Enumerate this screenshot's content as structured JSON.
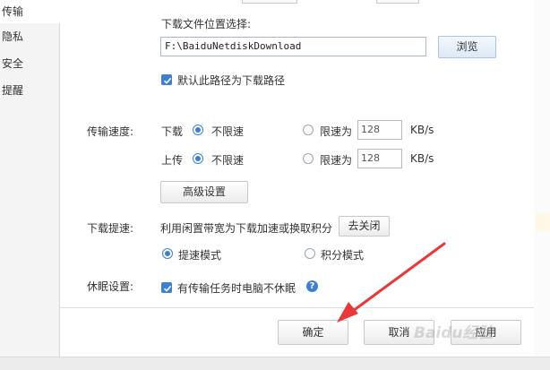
{
  "sidebar": {
    "items": [
      {
        "label": "传输",
        "active": true
      },
      {
        "label": "隐私",
        "active": false
      },
      {
        "label": "安全",
        "active": false
      },
      {
        "label": "提醒",
        "active": false
      }
    ]
  },
  "download_location": {
    "label": "下载文件位置选择:",
    "path": "F:\\BaiduNetdiskDownload",
    "browse_label": "浏览",
    "default_checkbox_label": "默认此路径为下载路径",
    "default_checked": true
  },
  "speed": {
    "label": "传输速度:",
    "download": {
      "label": "下载",
      "unlimited_label": "不限速",
      "limit_label": "限速为",
      "value": "128",
      "unit": "KB/s",
      "mode": "unlimited"
    },
    "upload": {
      "label": "上传",
      "unlimited_label": "不限速",
      "limit_label": "限速为",
      "value": "128",
      "unit": "KB/s",
      "mode": "unlimited"
    },
    "advanced_label": "高级设置"
  },
  "boost": {
    "label": "下载提速:",
    "description": "利用闲置带宽为下载加速或换取积分",
    "close_label": "去关闭",
    "speed_mode_label": "提速模式",
    "points_mode_label": "积分模式",
    "mode": "speed"
  },
  "sleep": {
    "label": "休眠设置:",
    "checkbox_label": "有传输任务时电脑不休眠",
    "checked": true,
    "help_glyph": "?"
  },
  "footer": {
    "ok_label": "确定",
    "cancel_label": "取消",
    "apply_label": "应用"
  },
  "watermark": "Baidu经验",
  "colors": {
    "accent": "#3f7fd0",
    "annotation_arrow": "#e8393a"
  }
}
